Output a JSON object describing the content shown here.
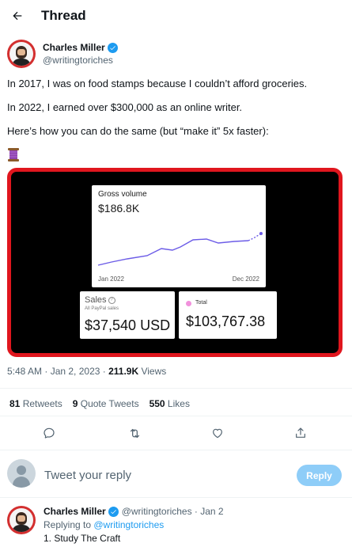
{
  "header": {
    "back_icon": "arrow-left-icon",
    "title": "Thread"
  },
  "tweet": {
    "author_name": "Charles Miller",
    "handle": "@writingtoriches",
    "verified": true,
    "lines": [
      "In 2017, I was on food stamps because I couldn’t afford groceries.",
      "In 2022, I earned over $300,000 as an online writer.",
      "Here’s how you can do the same (but “make it” 5x faster):"
    ],
    "emoji": "thread-spool-icon",
    "media": {
      "border_color": "#e0161e",
      "gross_volume": {
        "label": "Gross volume",
        "value": "$186.8K",
        "start_label": "Jan 2022",
        "end_label": "Dec 2022",
        "line_color": "#6c5ce7"
      },
      "sales": {
        "title": "Sales",
        "subtitle": "All PayPal sales",
        "value": "$37,540 USD"
      },
      "total": {
        "label": "Total",
        "value": "$103,767.38",
        "dot_color": "#f191dc"
      }
    },
    "time": "5:48 AM · Jan 2, 2023 · ",
    "views_count": "211.9K",
    "views_label": " Views",
    "stats": {
      "retweets_count": "81",
      "retweets_label": " Retweets",
      "quotes_count": "9",
      "quotes_label": " Quote Tweets",
      "likes_count": "550",
      "likes_label": " Likes"
    },
    "actions": [
      "reply-icon",
      "retweet-icon",
      "like-icon",
      "share-icon"
    ]
  },
  "composer": {
    "placeholder": "Tweet your reply",
    "button_label": "Reply",
    "button_color": "#8ecdf8"
  },
  "reply": {
    "author_name": "Charles Miller",
    "handle_date": "@writingtoriches · Jan 2",
    "replying_prefix": "Replying to ",
    "replying_handle": "@writingtoriches",
    "text": "1. Study The Craft"
  },
  "colors": {
    "accent": "#1d9bf0",
    "muted_text": "#536471"
  }
}
